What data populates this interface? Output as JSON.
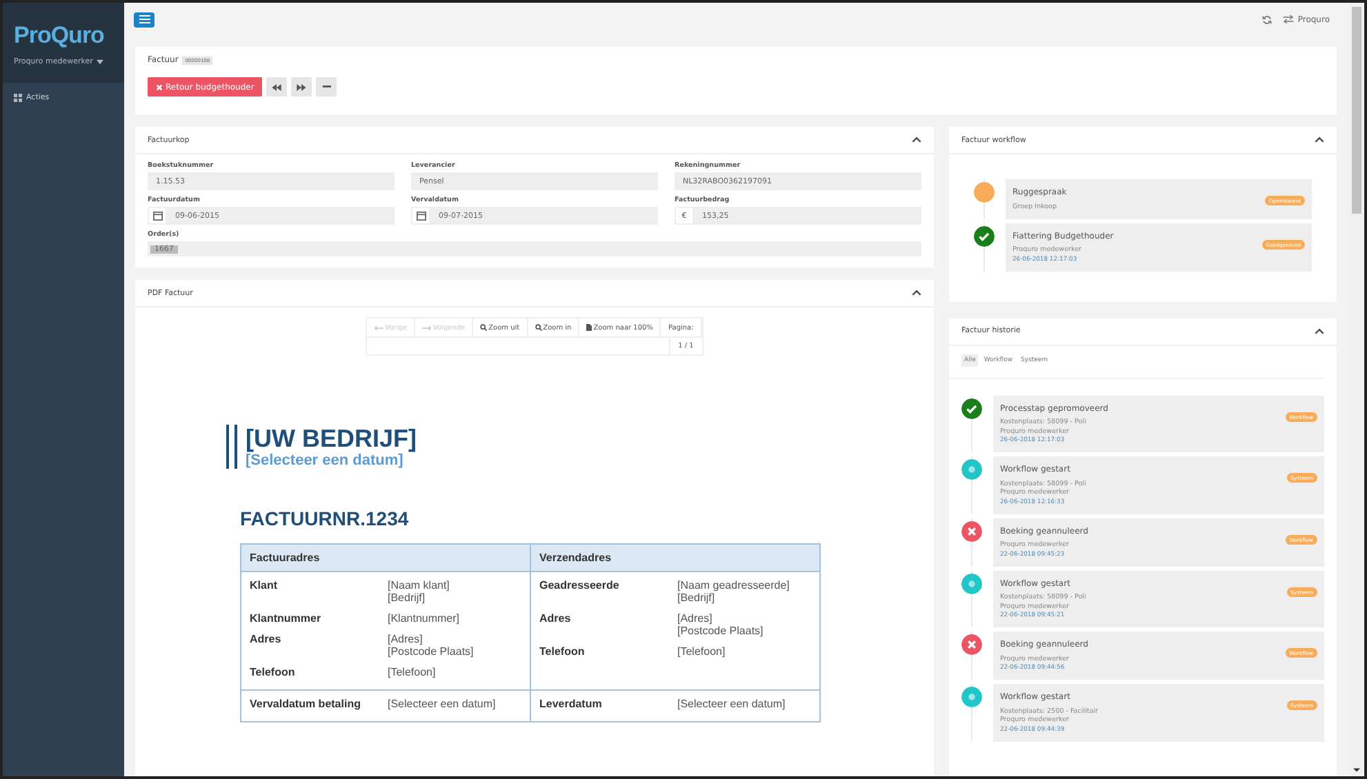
{
  "sidebar": {
    "logo": "ProQuro",
    "user": "Proquro medewerker",
    "items": [
      {
        "label": "Acties",
        "selected": false
      }
    ]
  },
  "topbar": {
    "user": "Proquro"
  },
  "invoice_header": {
    "title": "Factuur",
    "badge": "00000108",
    "actions": [
      {
        "kind": "return",
        "label": "Retour budgethouder"
      },
      {
        "kind": "first"
      },
      {
        "kind": "last"
      },
      {
        "kind": "more"
      }
    ]
  },
  "factuurkop": {
    "title": "Factuurkop",
    "fields": [
      {
        "label": "Boekstuknummer",
        "value": "1.15.53",
        "kind": "text"
      },
      {
        "label": "Leverancier",
        "value": "Pensel",
        "kind": "text"
      },
      {
        "label": "Rekeningnummer",
        "value": "NL32RABO0362197091",
        "kind": "text"
      },
      {
        "label": "Factuurdatum",
        "value": "09-06-2015",
        "kind": "date"
      },
      {
        "label": "Vervaldatum",
        "value": "09-07-2015",
        "kind": "date"
      },
      {
        "label": "Factuurbedrag",
        "value": "153,25",
        "kind": "amount",
        "addon": "€"
      },
      {
        "label": "Order(s)",
        "value": "1667",
        "kind": "tags"
      }
    ]
  },
  "pdf": {
    "title": "PDF Factuur",
    "toolbar": [
      {
        "kind": "prev",
        "label": "Vorige",
        "disabled": true
      },
      {
        "kind": "next",
        "label": "Volgende",
        "disabled": true
      },
      {
        "kind": "zoom",
        "label": "Zoom uit",
        "disabled": false
      },
      {
        "kind": "zoom",
        "label": "Zoom in",
        "disabled": false
      },
      {
        "kind": "page",
        "label": "Zoom naar 100%",
        "disabled": false
      },
      {
        "kind": "plain",
        "label": "Pagina:",
        "disabled": false
      }
    ],
    "page_indicator": "1 / 1",
    "company": "[UW BEDRIJF]",
    "date": "[Selecteer een datum]",
    "invoice_no": "FACTUURNR.1234",
    "headers": [
      "Factuuradres",
      "Verzendadres"
    ],
    "columns": [
      [
        {
          "label": "Klant",
          "lines": [
            "[Naam klant]",
            "[Bedrijf]"
          ]
        },
        {
          "label": "Klantnummer",
          "lines": [
            "[Klantnummer]"
          ]
        },
        {
          "label": "Adres",
          "lines": [
            "[Adres]",
            "[Postcode Plaats]"
          ]
        },
        {
          "label": "Telefoon",
          "lines": [
            "[Telefoon]"
          ]
        }
      ],
      [
        {
          "label": "Geadresseerde",
          "lines": [
            "[Naam geadresseerde]",
            "[Bedrijf]"
          ]
        },
        {
          "label": "Adres",
          "lines": [
            "[Adres]",
            "[Postcode Plaats]"
          ]
        },
        {
          "label": "Telefoon",
          "lines": [
            "[Telefoon]"
          ]
        }
      ]
    ],
    "footer": [
      {
        "label": "Vervaldatum betaling",
        "lines": [
          "[Selecteer een datum]"
        ]
      },
      {
        "label": "Leverdatum",
        "lines": [
          "[Selecteer een datum]"
        ]
      }
    ]
  },
  "workflow": {
    "title": "Factuur workflow",
    "steps": [
      {
        "kind": "pending",
        "title": "Ruggespraak",
        "lines": [
          "Groep Inkoop"
        ],
        "badge": "Openstaand"
      },
      {
        "kind": "done",
        "title": "Fiattering Budgethouder",
        "lines": [
          "Proquro medewerker"
        ],
        "time": "26-06-2018 12:17:03",
        "badge": "Goedgekeurd"
      }
    ]
  },
  "history": {
    "title": "Factuur historie",
    "filters": [
      {
        "label": "Alle",
        "selected": true
      },
      {
        "label": "Workflow",
        "selected": false
      },
      {
        "label": "Systeem",
        "selected": false
      }
    ],
    "events": [
      {
        "kind": "done",
        "title": "Processtap gepromoveerd",
        "lines": [
          "Kostenplaats: 58099 - Poli",
          "Proquro medewerker"
        ],
        "time": "26-06-2018 12:17:03",
        "badge": "Workflow"
      },
      {
        "kind": "info",
        "title": "Workflow gestart",
        "lines": [
          "Kostenplaats: 58099 - Poli",
          "Proquro medewerker"
        ],
        "time": "26-06-2018 12:16:33",
        "badge": "Systeem"
      },
      {
        "kind": "cancel",
        "title": "Boeking geannuleerd",
        "lines": [
          "Proquro medewerker"
        ],
        "time": "22-06-2018 09:45:23",
        "badge": "Workflow"
      },
      {
        "kind": "info",
        "title": "Workflow gestart",
        "lines": [
          "Kostenplaats: 58099 - Poli",
          "Proquro medewerker"
        ],
        "time": "22-06-2018 09:45:21",
        "badge": "Systeem"
      },
      {
        "kind": "cancel",
        "title": "Boeking geannuleerd",
        "lines": [
          "Proquro medewerker"
        ],
        "time": "22-06-2018 09:44:56",
        "badge": "Workflow"
      },
      {
        "kind": "info",
        "title": "Workflow gestart",
        "lines": [
          "Kostenplaats: 2500 - Facilitair",
          "Proquro medewerker"
        ],
        "time": "22-06-2018 09:44:39",
        "badge": "Systeem"
      }
    ]
  }
}
